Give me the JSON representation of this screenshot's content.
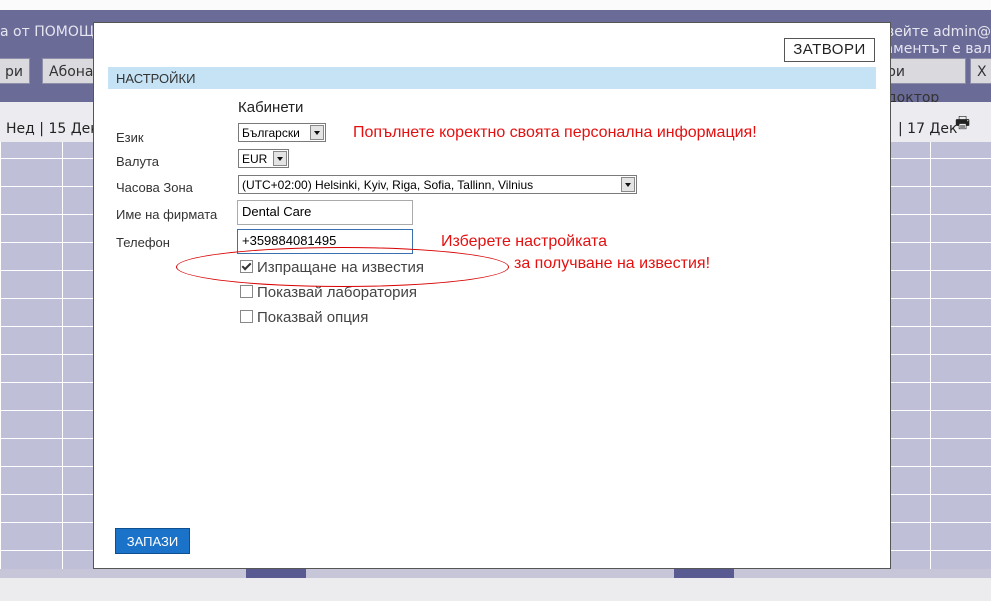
{
  "background": {
    "header_left": "а от ПОМОЩ",
    "header_right_1": "вейте admin@",
    "header_right_2": "аментът е вал",
    "buttons": [
      "ри",
      "Абона",
      "ри доктор",
      "X"
    ],
    "day_left": "Нед | 15 Дек",
    "day_right": "| 17 Дек",
    "printer_icon": "printer-icon",
    "colors": {
      "header": "#6b6b98",
      "grid": "#bfc0d7"
    }
  },
  "modal": {
    "close_label": "ЗАТВОРИ",
    "section_title": "НАСТРОЙКИ",
    "cabinets_label": "Кабинети",
    "fields": {
      "language": {
        "label": "Език",
        "value": "Български"
      },
      "currency": {
        "label": "Валута",
        "value": "EUR"
      },
      "timezone": {
        "label": "Часова Зона",
        "value": "(UTC+02:00) Helsinki, Kyiv, Riga, Sofia, Tallinn, Vilnius"
      },
      "company": {
        "label": "Име на фирмата",
        "value": "Dental Care"
      },
      "phone": {
        "label": "Телефон",
        "value": "+359884081495"
      }
    },
    "checkboxes": [
      {
        "label": "Изпращане на известия",
        "checked": true
      },
      {
        "label": "Показвай лаборатория",
        "checked": false
      },
      {
        "label": "Показвай опция",
        "checked": false
      }
    ],
    "annotations": {
      "personal_info": "Попълнете коректно своята персонална информация!",
      "notify_line1": "Изберете настройката",
      "notify_line2": "за получване на известия!"
    },
    "save_label": "ЗАПАЗИ",
    "colors": {
      "section_bar": "#c5e3f5",
      "save_button": "#1a73c8",
      "annotation": "#e41010"
    }
  }
}
